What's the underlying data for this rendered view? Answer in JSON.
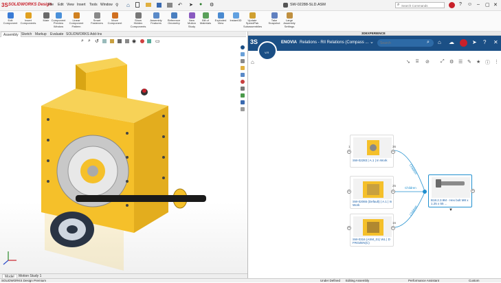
{
  "app": {
    "brand": "SOLIDWORKS Design",
    "menus": [
      "File",
      "Edit",
      "View",
      "Insert",
      "Tools",
      "Window"
    ],
    "doc_title": "SW-02288-SLD.ASM",
    "search_placeholder": "Search Commands",
    "win_min": "–",
    "win_max": "▢",
    "win_close": "✕"
  },
  "ribbon": {
    "buttons": [
      {
        "label": "Edit\nComponent",
        "color": "#3a7bd5"
      },
      {
        "label": "Insert\nComponents",
        "color": "#e0a020"
      },
      {
        "label": "Mate",
        "color": "#6a6a6a"
      },
      {
        "label": "Component\nPreview\nWindow",
        "color": "#4a90d9"
      },
      {
        "label": "Linear Component\nPattern",
        "color": "#d08020"
      },
      {
        "label": "Smart\nFasteners",
        "color": "#888"
      },
      {
        "label": "Move\nComponent",
        "color": "#d07020"
      },
      {
        "label": "Show\nHidden\nComponents",
        "color": "#777"
      },
      {
        "label": "Assembly\nFeatures",
        "color": "#5a8ac8"
      },
      {
        "label": "Reference\nGeometry",
        "color": "#4a7fc0"
      },
      {
        "label": "New\nMotion\nStudy",
        "color": "#8a5ac0"
      },
      {
        "label": "Bill of\nMaterials",
        "color": "#5aa05a"
      },
      {
        "label": "Exploded\nView",
        "color": "#4a8ad0"
      },
      {
        "label": "Instant3D",
        "color": "#60a0e0"
      },
      {
        "label": "Update\nSpeedPak\nSubassemblies",
        "color": "#d0a030"
      },
      {
        "label": "Take\nSnapshot",
        "color": "#6080c0"
      },
      {
        "label": "Large\nAssembly\nSettings",
        "color": "#c09040"
      }
    ]
  },
  "tabs": [
    "Assembly",
    "Sketch",
    "Markup",
    "Evaluate",
    "SOLIDWORKS Add-Ins"
  ],
  "bottom_tabs": [
    "Model",
    "Motion Study 1"
  ],
  "status": {
    "left": "SOLIDWORKS Design Premium",
    "under_defined": "Under Defined",
    "editing": "Editing Assembly",
    "perf": "Performance Assistant",
    "custom": "Custom"
  },
  "panel": {
    "header": "3DEXPERIENCE",
    "app_name": "ENOVIA",
    "app_title": "Relations - RII Relations (Compass ...",
    "search_placeholder": "Search",
    "compass_label": "V.R",
    "nodes": [
      {
        "label": "SW-02283 | A.1 | In Work",
        "count": "36"
      },
      {
        "label": "SW-02065 (Default) | A.1 | In Work",
        "count": "25"
      },
      {
        "label": "SW-0316 (ASM_01) WL | D FROZEN(C)",
        "count": "16"
      },
      {
        "label": "B18.2.3.9M - Hex bolt M8 x 1.25 x 55 ...",
        "count": "1"
      }
    ],
    "edge_label": "Children"
  },
  "colors": {
    "accent": "#1f8fcf",
    "enovia_bar": "#1b4f85",
    "part_yellow": "#f5c02a",
    "ds_red": "#c8202a"
  }
}
